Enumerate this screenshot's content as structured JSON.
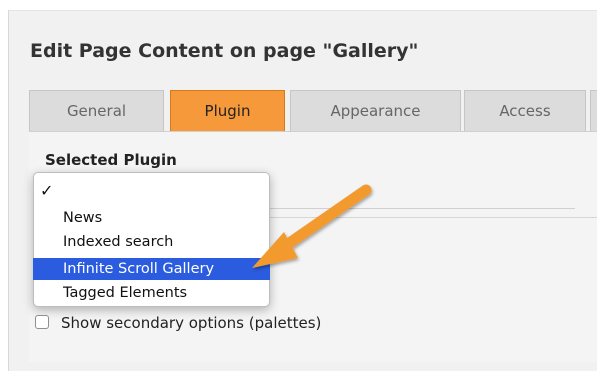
{
  "page": {
    "title": "Edit Page Content on page \"Gallery\""
  },
  "tabs": [
    {
      "label": "General",
      "active": false
    },
    {
      "label": "Plugin",
      "active": true
    },
    {
      "label": "Appearance",
      "active": false
    },
    {
      "label": "Access",
      "active": false
    },
    {
      "label": "",
      "active": false
    }
  ],
  "plugin_field": {
    "label": "Selected Plugin",
    "check_mark": "✓",
    "options": [
      {
        "label": "News",
        "selected": false
      },
      {
        "label": "Indexed search",
        "selected": false
      },
      {
        "label": "Infinite Scroll Gallery",
        "selected": true
      },
      {
        "label": "Tagged Elements",
        "selected": false
      }
    ]
  },
  "secondary_options": {
    "label": "Show secondary options (palettes)",
    "checked": false
  },
  "colors": {
    "active_tab": "#f6993a",
    "selection": "#2b5ce0",
    "arrow": "#f29a2e"
  }
}
